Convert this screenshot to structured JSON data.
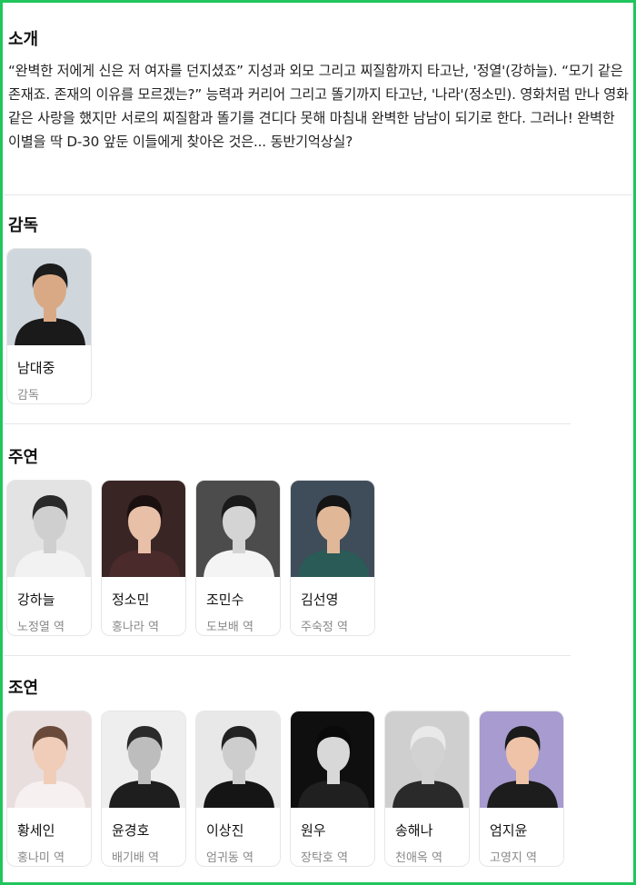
{
  "intro": {
    "title": "소개",
    "text": "“완벽한 저에게 신은 저 여자를 던지셨죠” 지성과 외모 그리고 찌질함까지 타고난, '정열'(강하늘). “모기 같은 존재죠. 존재의 이유를 모르겠는?” 능력과 커리어 그리고 똘기까지 타고난, '나라'(정소민). 영화처럼 만나 영화같은 사랑을 했지만 서로의 찌질함과 똘기를 견디다 못해 마침내 완벽한 남남이 되기로 한다. 그러나! 완벽한 이별을 딱 D-30 앞둔 이들에게 찾아온 것은... 동반기억상실?"
  },
  "director": {
    "title": "감독",
    "people": [
      {
        "name": "남대중",
        "role": "감독",
        "bg": "#cfd6dc",
        "skin": "#d9a985",
        "hair": "#1c1c1c",
        "cloth": "#1a1a1a"
      }
    ]
  },
  "lead": {
    "title": "주연",
    "people": [
      {
        "name": "강하늘",
        "role": "노정열 역",
        "bg": "#e3e3e3",
        "skin": "#cfcfcf",
        "hair": "#2a2a2a",
        "cloth": "#f2f2f2"
      },
      {
        "name": "정소민",
        "role": "홍나라 역",
        "bg": "#3a2525",
        "skin": "#e8c0a8",
        "hair": "#1b1010",
        "cloth": "#4a2a2a"
      },
      {
        "name": "조민수",
        "role": "도보배 역",
        "bg": "#4c4c4c",
        "skin": "#d4d4d4",
        "hair": "#1a1a1a",
        "cloth": "#f4f4f4"
      },
      {
        "name": "김선영",
        "role": "주숙정 역",
        "bg": "#3f4c5a",
        "skin": "#e0b898",
        "hair": "#141414",
        "cloth": "#2b5b57"
      }
    ]
  },
  "support": {
    "title": "조연",
    "people": [
      {
        "name": "황세인",
        "role": "홍나미 역",
        "bg": "#e9dede",
        "skin": "#f0cdb8",
        "hair": "#6a4a3a",
        "cloth": "#f6f0f0"
      },
      {
        "name": "윤경호",
        "role": "배기배 역",
        "bg": "#eeeeee",
        "skin": "#bdbdbd",
        "hair": "#2a2a2a",
        "cloth": "#1e1e1e"
      },
      {
        "name": "이상진",
        "role": "엄귀동 역",
        "bg": "#e8e8e8",
        "skin": "#cdcdcd",
        "hair": "#222222",
        "cloth": "#151515"
      },
      {
        "name": "원우",
        "role": "장탁호 역",
        "bg": "#0f0f0f",
        "skin": "#d8d8d8",
        "hair": "#0a0a0a",
        "cloth": "#202020"
      },
      {
        "name": "송해나",
        "role": "천애옥 역",
        "bg": "#cfcfcf",
        "skin": "#d2d2d2",
        "hair": "#e9e9e9",
        "cloth": "#2a2a2a"
      },
      {
        "name": "엄지윤",
        "role": "고영지 역",
        "bg": "#a79bcf",
        "skin": "#efc3a8",
        "hair": "#1b1b1b",
        "cloth": "#1d1d1d"
      }
    ]
  }
}
